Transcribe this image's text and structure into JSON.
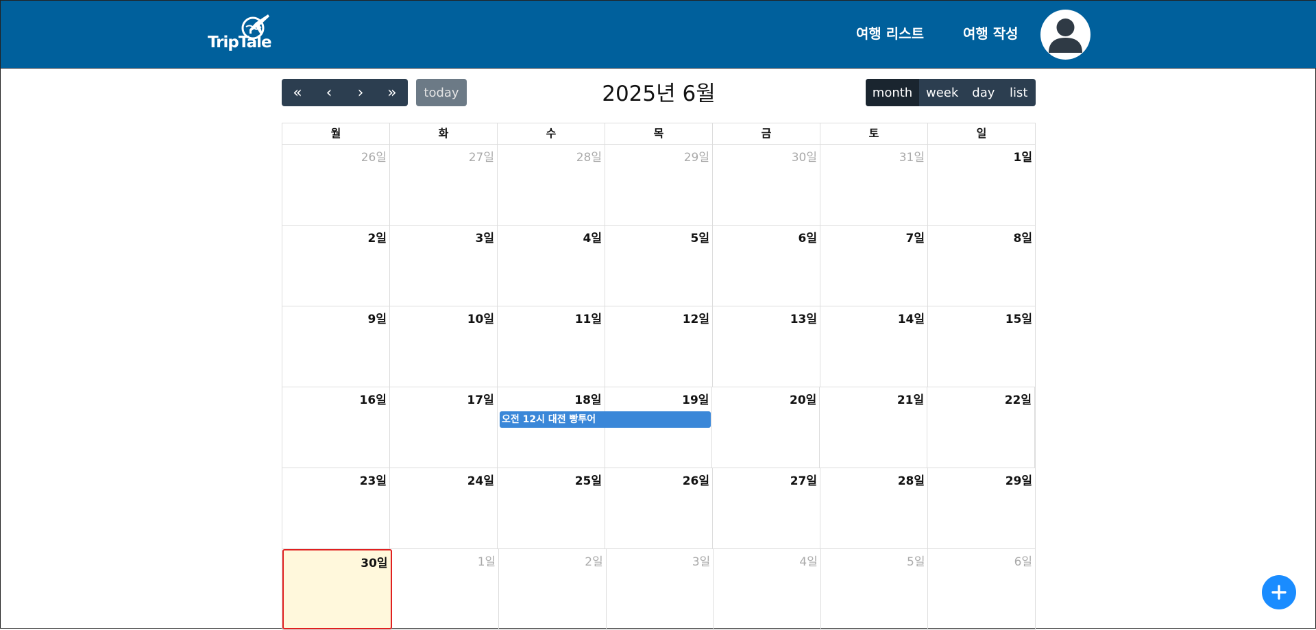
{
  "header": {
    "logo_text": "TripTale",
    "nav": {
      "list": "여행 리스트",
      "write": "여행 작성"
    }
  },
  "toolbar": {
    "prev_year": "«",
    "prev": "‹",
    "next": "›",
    "next_year": "»",
    "today": "today",
    "title": "2025년 6월",
    "views": {
      "month": "month",
      "week": "week",
      "day": "day",
      "list": "list"
    },
    "active_view": "month"
  },
  "calendar": {
    "weekdays": [
      "월",
      "화",
      "수",
      "목",
      "금",
      "토",
      "일"
    ],
    "weeks": [
      [
        {
          "d": "26일",
          "other": true
        },
        {
          "d": "27일",
          "other": true
        },
        {
          "d": "28일",
          "other": true
        },
        {
          "d": "29일",
          "other": true
        },
        {
          "d": "30일",
          "other": true
        },
        {
          "d": "31일",
          "other": true
        },
        {
          "d": "1일"
        }
      ],
      [
        {
          "d": "2일"
        },
        {
          "d": "3일"
        },
        {
          "d": "4일"
        },
        {
          "d": "5일"
        },
        {
          "d": "6일"
        },
        {
          "d": "7일"
        },
        {
          "d": "8일"
        }
      ],
      [
        {
          "d": "9일"
        },
        {
          "d": "10일"
        },
        {
          "d": "11일"
        },
        {
          "d": "12일"
        },
        {
          "d": "13일"
        },
        {
          "d": "14일"
        },
        {
          "d": "15일"
        }
      ],
      [
        {
          "d": "16일"
        },
        {
          "d": "17일"
        },
        {
          "d": "18일"
        },
        {
          "d": "19일"
        },
        {
          "d": "20일"
        },
        {
          "d": "21일"
        },
        {
          "d": "22일"
        }
      ],
      [
        {
          "d": "23일"
        },
        {
          "d": "24일"
        },
        {
          "d": "25일"
        },
        {
          "d": "26일"
        },
        {
          "d": "27일"
        },
        {
          "d": "28일"
        },
        {
          "d": "29일"
        }
      ],
      [
        {
          "d": "30일",
          "today": true
        },
        {
          "d": "1일",
          "other": true
        },
        {
          "d": "2일",
          "other": true
        },
        {
          "d": "3일",
          "other": true
        },
        {
          "d": "4일",
          "other": true
        },
        {
          "d": "5일",
          "other": true
        },
        {
          "d": "6일",
          "other": true
        }
      ]
    ],
    "event": {
      "title": "오전 12시 대전 빵투어",
      "color": "#3a87d8"
    }
  },
  "colors": {
    "header_bg": "#00609c",
    "button_bg": "#2c3e50",
    "today_highlight": "#fff8dc",
    "today_border": "#e02020",
    "fab": "#1a8cff"
  },
  "fab_icon": "plus-icon"
}
